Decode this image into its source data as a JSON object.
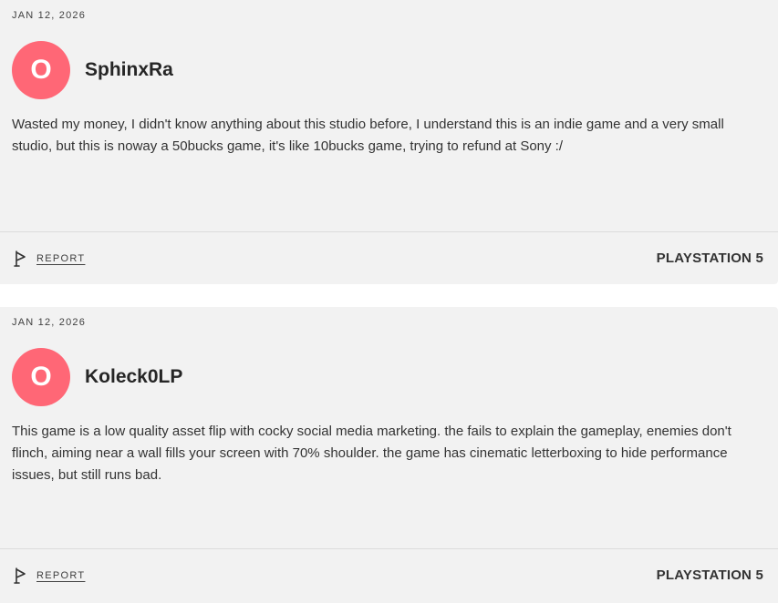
{
  "reviews": [
    {
      "date": "JAN 12, 2026",
      "avatar_initial": "O",
      "avatar_color": "#ff6776",
      "username": "SphinxRa",
      "body": "Wasted my money, I didn't know anything about this studio before, I understand this is an indie game and a very small studio, but this is noway a 50bucks game, it's like 10bucks game, trying to refund at Sony :/",
      "report_label": "REPORT",
      "report_icon": "flag-icon",
      "platform": "PLAYSTATION 5"
    },
    {
      "date": "JAN 12, 2026",
      "avatar_initial": "O",
      "avatar_color": "#ff6776",
      "username": "Koleck0LP",
      "body": "This game is a low quality asset flip with cocky social media marketing. the fails to explain the gameplay, enemies don't flinch, aiming near a wall fills your screen with 70% shoulder. the game has cinematic letterboxing to hide performance issues, but still runs bad.",
      "report_label": "REPORT",
      "report_icon": "flag-icon",
      "platform": "PLAYSTATION 5"
    }
  ]
}
